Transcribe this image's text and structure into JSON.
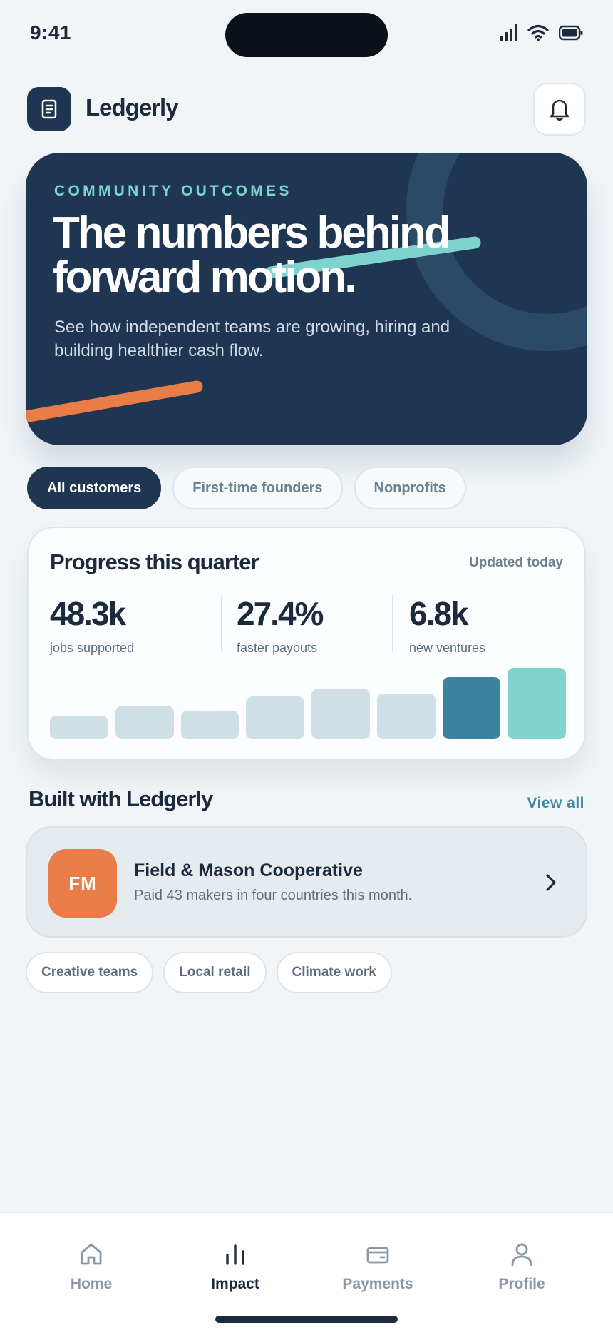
{
  "status_bar": {
    "time": "9:41"
  },
  "header": {
    "brand": "Ledgerly"
  },
  "hero": {
    "eyebrow": "COMMUNITY OUTCOMES",
    "title": "The numbers behind forward motion.",
    "subtitle": "See how independent teams are growing, hiring and building healthier cash flow."
  },
  "filters": [
    {
      "label": "All customers",
      "active": true
    },
    {
      "label": "First-time founders",
      "active": false
    },
    {
      "label": "Nonprofits",
      "active": false
    }
  ],
  "progress": {
    "title": "Progress this quarter",
    "meta": "Updated today",
    "stats": [
      {
        "value": "48.3k",
        "label": "jobs supported"
      },
      {
        "value": "27.4%",
        "label": "faster payouts"
      },
      {
        "value": "6.8k",
        "label": "new ventures"
      }
    ],
    "bars": [
      30,
      42,
      36,
      54,
      64,
      58,
      78,
      90
    ],
    "bar_colors": [
      "#cfdfe6",
      "#cfdfe6",
      "#cfdfe6",
      "#cfdfe6",
      "#cfdfe6",
      "#cfdfe6",
      "#3b84a0",
      "#81d3d0"
    ]
  },
  "built_with": {
    "title": "Built with Ledgerly",
    "view_all": "View all",
    "customer": {
      "initials": "FM",
      "name": "Field & Mason Cooperative",
      "description": "Paid 43 makers in four countries this month."
    },
    "tags": [
      "Creative teams",
      "Local retail",
      "Climate work"
    ]
  },
  "tab_bar": {
    "tabs": [
      {
        "label": "Home",
        "icon": "home-icon",
        "active": false
      },
      {
        "label": "Impact",
        "icon": "chart-icon",
        "active": true
      },
      {
        "label": "Payments",
        "icon": "wallet-icon",
        "active": false
      },
      {
        "label": "Profile",
        "icon": "person-icon",
        "active": false
      }
    ]
  },
  "colors": {
    "navy": "#1f3652",
    "teal": "#7fd3cf",
    "orange": "#ea7c48",
    "link": "#3e8aa4"
  }
}
